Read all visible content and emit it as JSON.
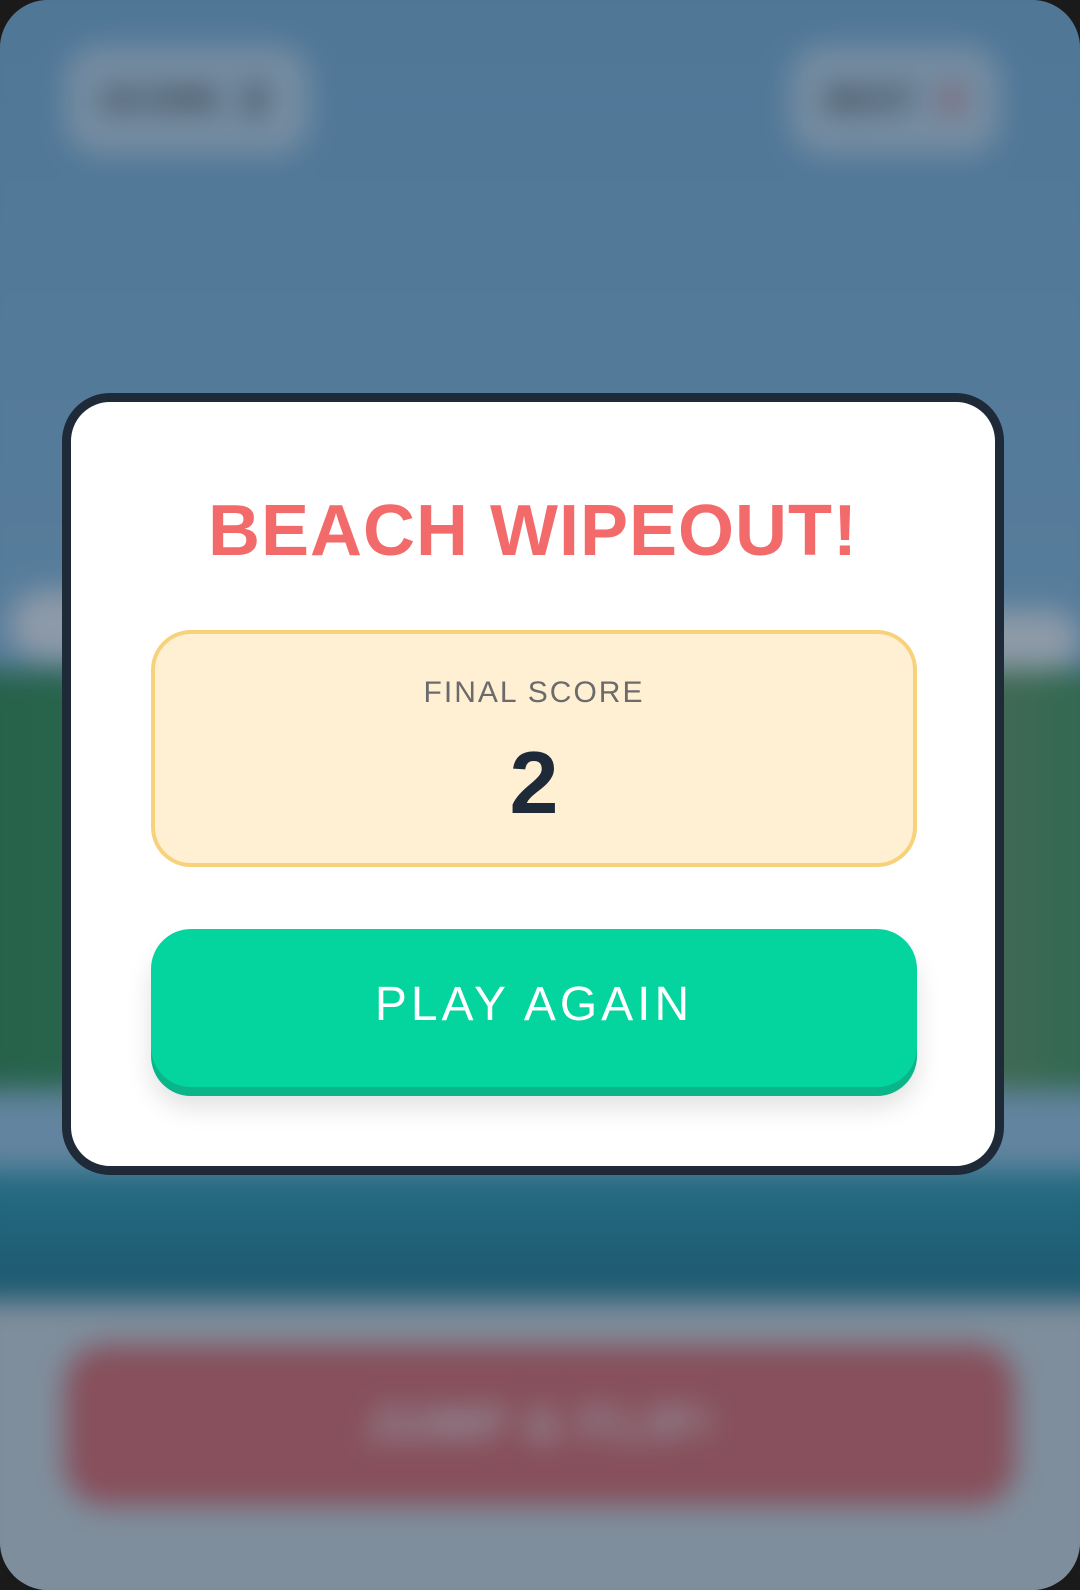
{
  "hud": {
    "score_label": "SCORE",
    "score_value": "2",
    "best_label": "BEST",
    "best_value": "8"
  },
  "game_over": {
    "title": "BEACH WIPEOUT!",
    "final_score_label": "FINAL SCORE",
    "final_score_value": "2",
    "play_again_label": "PLAY AGAIN"
  },
  "controls": {
    "jump_label": "JUMP & FLIP!"
  },
  "colors": {
    "title": "#f26a6a",
    "play_button": "#04d49e",
    "score_box_bg": "#fff0d4",
    "score_box_border": "#f7d27a",
    "modal_border": "#1e2a38"
  }
}
